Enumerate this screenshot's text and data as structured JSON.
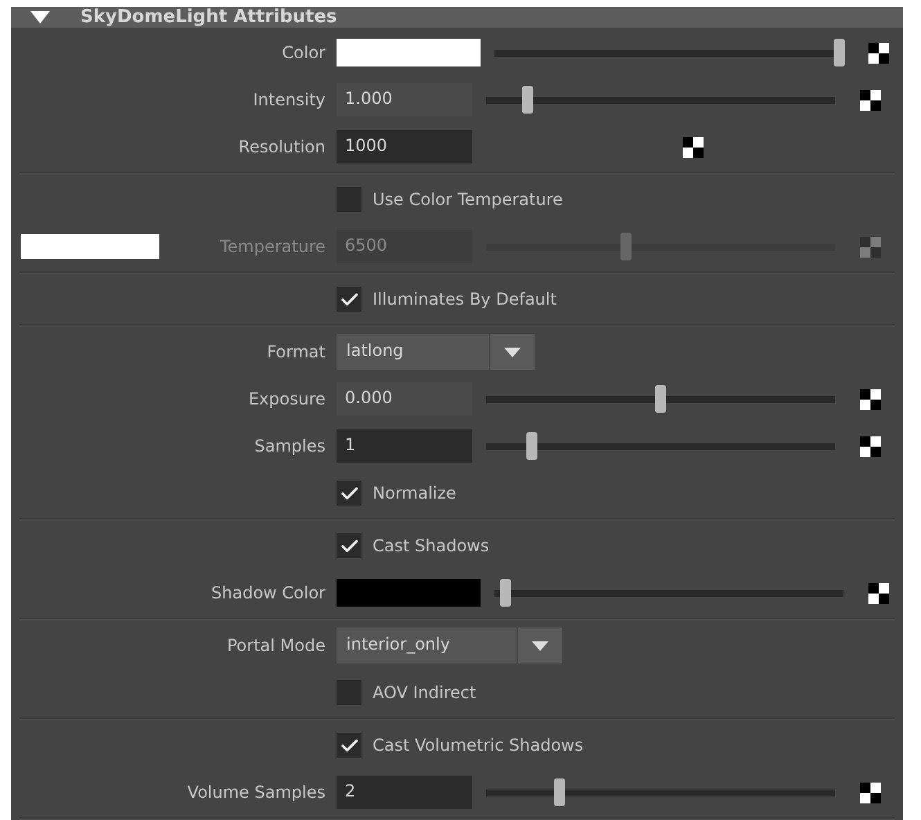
{
  "header": {
    "title": "SkyDomeLight Attributes",
    "expanded": true
  },
  "sections": [
    {
      "rows": [
        {
          "kind": "color",
          "label": "Color",
          "color": "#ffffff",
          "level": 0.99
        },
        {
          "kind": "float",
          "label": "Intensity",
          "value": "1.000",
          "level": 0.12
        },
        {
          "kind": "int_plain",
          "label": "Resolution",
          "value": "1000"
        }
      ]
    },
    {
      "rows": [
        {
          "kind": "checkbox",
          "label": "Use Color Temperature",
          "checked": false
        },
        {
          "kind": "temperature",
          "label": "Temperature",
          "value": "6500",
          "color": "#ffffff",
          "level": 0.4,
          "disabled": true
        }
      ]
    },
    {
      "rows": [
        {
          "kind": "checkbox",
          "label": "Illuminates By Default",
          "checked": true
        }
      ]
    },
    {
      "rows": [
        {
          "kind": "enum",
          "label": "Format",
          "value": "latlong"
        },
        {
          "kind": "float",
          "label": "Exposure",
          "value": "0.000",
          "level": 0.5
        },
        {
          "kind": "int",
          "label": "Samples",
          "value": "1",
          "level": 0.13
        },
        {
          "kind": "checkbox",
          "label": "Normalize",
          "checked": true
        }
      ]
    },
    {
      "rows": [
        {
          "kind": "checkbox",
          "label": "Cast Shadows",
          "checked": true
        },
        {
          "kind": "color",
          "label": "Shadow Color",
          "color": "#000000",
          "level": 0.03
        }
      ]
    },
    {
      "rows": [
        {
          "kind": "enum",
          "label": "Portal Mode",
          "value": "interior_only"
        },
        {
          "kind": "checkbox",
          "label": "AOV Indirect",
          "checked": false
        }
      ]
    },
    {
      "rows": [
        {
          "kind": "checkbox",
          "label": "Cast Volumetric Shadows",
          "checked": true
        },
        {
          "kind": "int",
          "label": "Volume Samples",
          "value": "2",
          "level": 0.21
        }
      ]
    }
  ]
}
